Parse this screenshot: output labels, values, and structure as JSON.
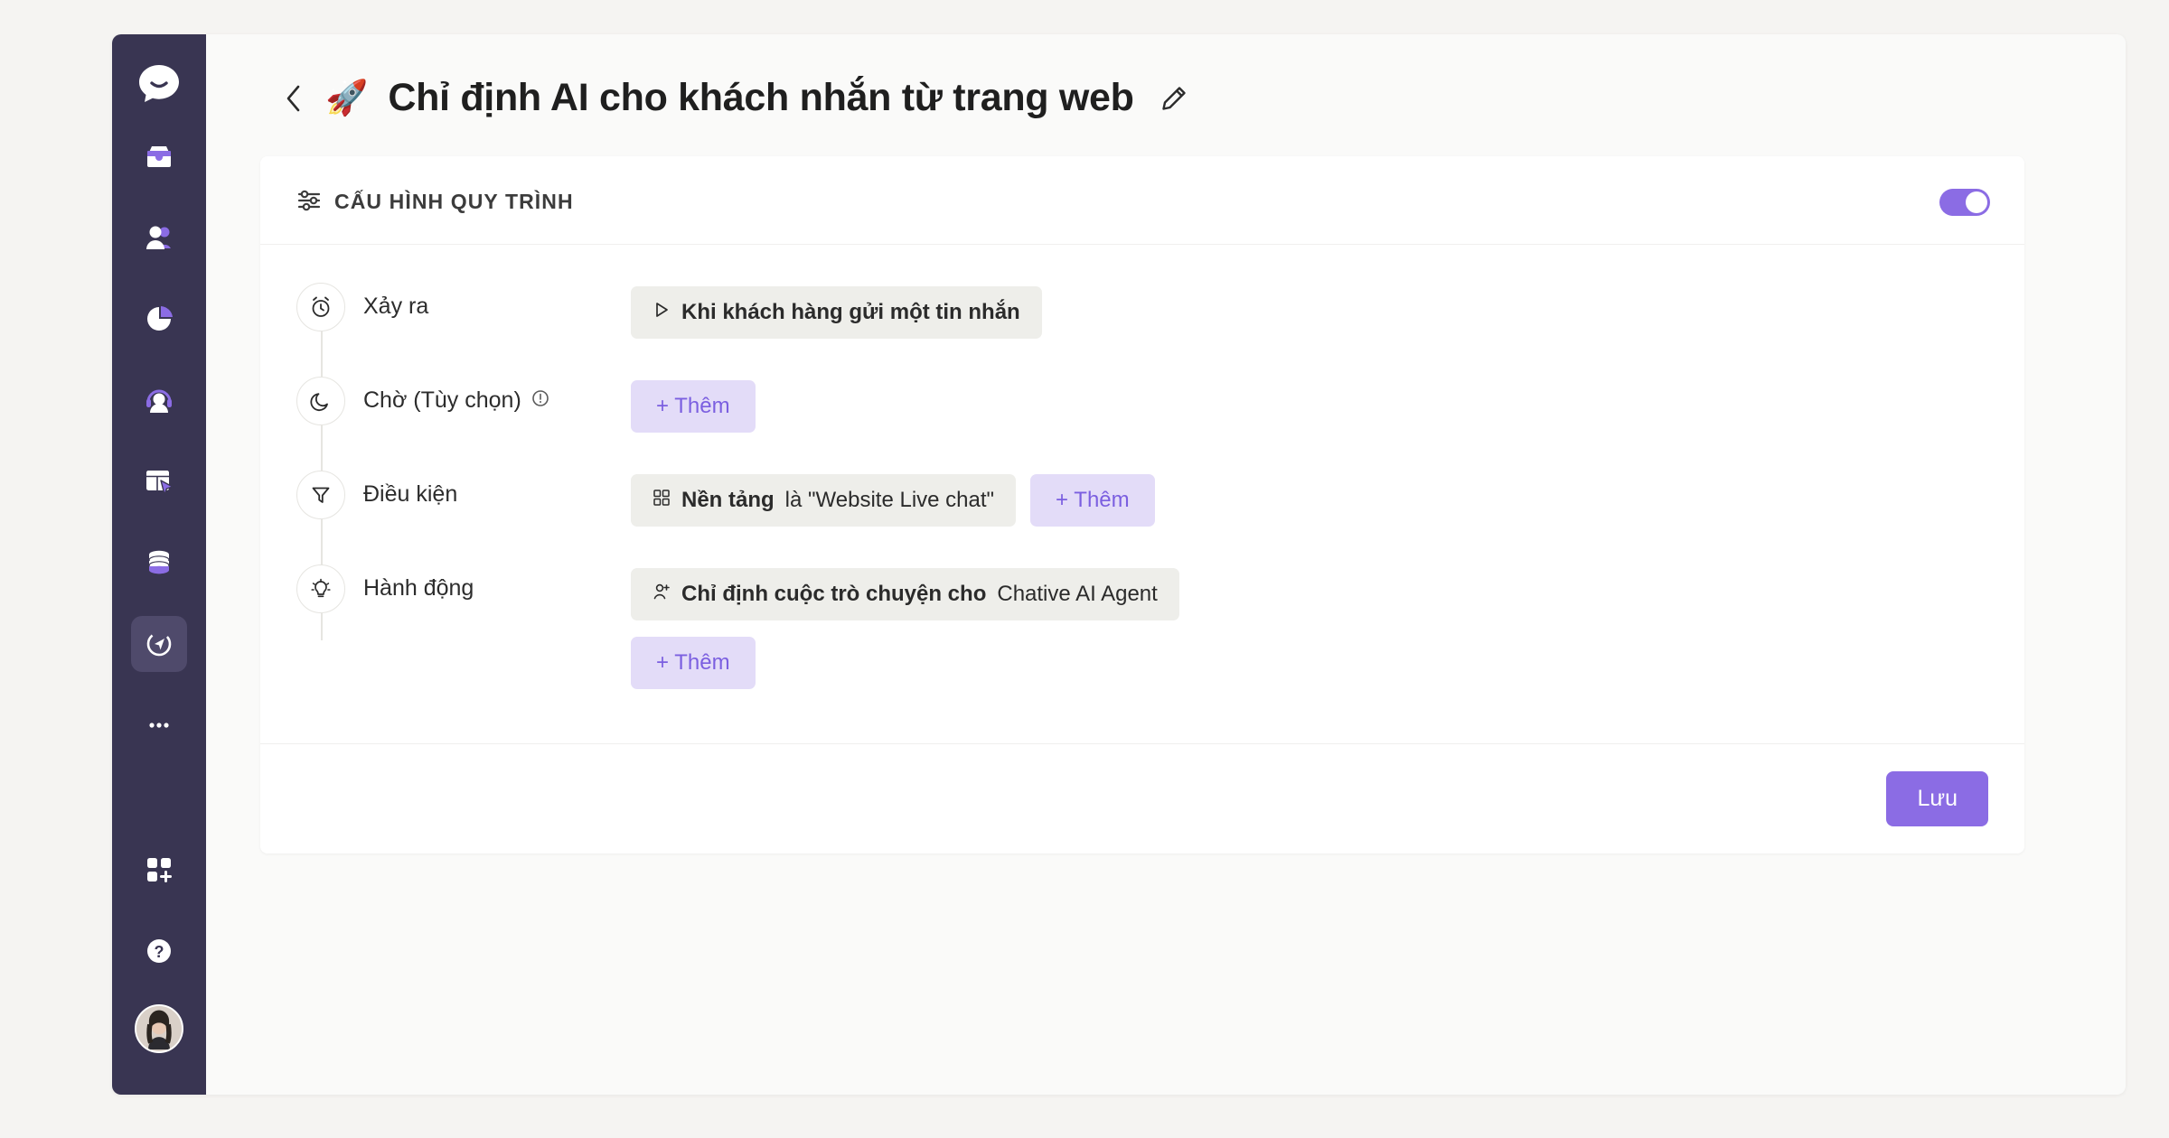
{
  "sidebar": {
    "logo_icon": "chat-bubble-logo",
    "items": [
      {
        "icon": "inbox-icon",
        "name": "inbox",
        "active": false
      },
      {
        "icon": "contacts-icon",
        "name": "contacts",
        "active": false
      },
      {
        "icon": "pie-chart-icon",
        "name": "reports",
        "active": false
      },
      {
        "icon": "headset-icon",
        "name": "agents",
        "active": false
      },
      {
        "icon": "browser-click-icon",
        "name": "channels",
        "active": false
      },
      {
        "icon": "database-icon",
        "name": "data",
        "active": false
      },
      {
        "icon": "automation-icon",
        "name": "automation",
        "active": true
      }
    ],
    "more_icon": "more-dots-icon",
    "apps_icon": "apps-grid-plus-icon",
    "help_icon": "help-question-icon",
    "avatar_icon": "user-avatar"
  },
  "header": {
    "back_icon": "chevron-left-icon",
    "emoji": "🚀",
    "title": "Chỉ định AI cho khách nhắn từ trang web",
    "edit_icon": "pencil-edit-icon"
  },
  "card": {
    "section_icon": "sliders-icon",
    "section_title": "CẤU HÌNH QUY TRÌNH",
    "toggle": {
      "name": "workflow-enabled-toggle",
      "enabled": true
    },
    "save_label": "Lưu",
    "add_label": "+ Thêm"
  },
  "steps": [
    {
      "icon": "alarm-clock-icon",
      "label": "Xảy ra",
      "has_info": false,
      "chips": [
        {
          "icon": "play-triangle-icon",
          "strong": "Khi khách hàng gửi một tin nhắn",
          "normal": ""
        }
      ],
      "add_button": false
    },
    {
      "icon": "moon-icon",
      "label": "Chờ (Tùy chọn)",
      "has_info": true,
      "info_icon": "info-circle-icon",
      "chips": [],
      "add_button": true
    },
    {
      "icon": "filter-funnel-icon",
      "label": "Điều kiện",
      "has_info": false,
      "chips": [
        {
          "icon": "grid-squares-icon",
          "strong": "Nền tảng",
          "normal": "là \"Website Live chat\""
        }
      ],
      "add_button": true
    },
    {
      "icon": "lightbulb-icon",
      "label": "Hành động",
      "has_info": false,
      "chips": [
        {
          "icon": "user-plus-icon",
          "strong": "Chỉ định cuộc trò chuyện cho",
          "normal": "Chative AI Agent"
        }
      ],
      "add_button": true,
      "add_below": true
    }
  ],
  "colors": {
    "accent_purple": "#8b6ce4",
    "accent_light": "#e3dcf8",
    "sidebar_navy": "#393552",
    "chip_gray": "#eeeeea",
    "page_bg": "#f5f4f2"
  }
}
